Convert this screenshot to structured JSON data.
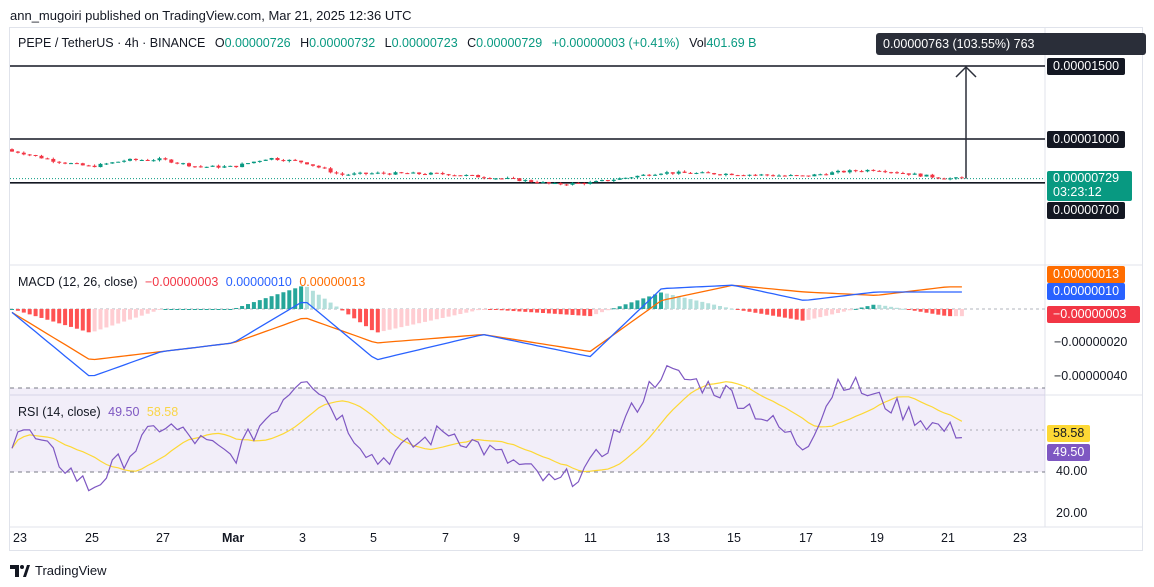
{
  "publisher": "ann_mugoiri published on TradingView.com, Mar 21, 2025 12:36 UTC",
  "legend": {
    "symbol": "PEPE / TetherUS · 4h · BINANCE",
    "open_label": "O",
    "open": "0.00000726",
    "high_label": "H",
    "high": "0.00000732",
    "low_label": "L",
    "low": "0.00000723",
    "close_label": "C",
    "close": "0.00000729",
    "change": "+0.00000003 (+0.41%)",
    "vol_label": "Vol",
    "vol": "401.69 B"
  },
  "measure_label": "0.00000763 (103.55%) 763",
  "price_axis": {
    "level_1500": "0.00001500",
    "level_1000": "0.00001000",
    "current": "0.00000729",
    "countdown": "03:23:12",
    "level_700": "0.00000700"
  },
  "macd": {
    "title": "MACD (12, 26, close)",
    "hist_value": "−0.00000003",
    "macd_value": "0.00000010",
    "signal_value": "0.00000013",
    "axis": {
      "signal_badge": "0.00000013",
      "macd_badge": "0.00000010",
      "hist_badge": "−0.00000003",
      "tick_20": "−0.00000020",
      "tick_40": "−0.00000040"
    }
  },
  "rsi": {
    "title": "RSI (14, close)",
    "rsi_value": "49.50",
    "ma_value": "58.58",
    "axis": {
      "ma_badge": "58.58",
      "rsi_badge": "49.50",
      "tick_40": "40.00",
      "tick_20": "20.00"
    }
  },
  "time_axis": [
    "23",
    "25",
    "27",
    "Mar",
    "3",
    "5",
    "7",
    "9",
    "11",
    "13",
    "15",
    "17",
    "19",
    "21",
    "23"
  ],
  "footer": "TradingView",
  "colors": {
    "up": "#089981",
    "down": "#f23645",
    "macd": "#2962ff",
    "signal": "#ff6d00",
    "hist_up_strong": "#26a69a",
    "hist_up_weak": "#b2dfdb",
    "hist_dn_strong": "#ff5252",
    "hist_dn_weak": "#ffcdd2",
    "rsi": "#7e57c2",
    "rsi_ma": "#fdd835"
  },
  "chart_data": {
    "type": "candlestick",
    "title": "PEPE / TetherUS · 4h · BINANCE",
    "ohlc_sample": [
      {
        "t": "Feb 22",
        "o": 9.3,
        "h": 9.4,
        "l": 9.2,
        "c": 9.3
      },
      {
        "t": "Feb 23",
        "o": 9.25,
        "h": 9.35,
        "l": 9.05,
        "c": 9.1
      },
      {
        "t": "Feb 24",
        "o": 9.0,
        "h": 9.05,
        "l": 8.4,
        "c": 8.5
      },
      {
        "t": "Feb 25",
        "o": 8.2,
        "h": 8.35,
        "l": 8.0,
        "c": 8.1
      },
      {
        "t": "Feb 26",
        "o": 8.4,
        "h": 8.6,
        "l": 8.35,
        "c": 8.55
      },
      {
        "t": "Feb 27",
        "o": 8.55,
        "h": 8.7,
        "l": 8.5,
        "c": 8.6
      },
      {
        "t": "Feb 28",
        "o": 8.3,
        "h": 8.4,
        "l": 8.0,
        "c": 8.1
      },
      {
        "t": "Mar 1",
        "o": 8.05,
        "h": 8.2,
        "l": 7.95,
        "c": 8.1
      },
      {
        "t": "Mar 2",
        "o": 8.4,
        "h": 8.8,
        "l": 8.3,
        "c": 8.7
      },
      {
        "t": "Mar 3",
        "o": 8.9,
        "h": 8.95,
        "l": 8.3,
        "c": 8.4
      },
      {
        "t": "Mar 4",
        "o": 7.7,
        "h": 7.8,
        "l": 7.4,
        "c": 7.55
      },
      {
        "t": "Mar 5",
        "o": 7.6,
        "h": 7.75,
        "l": 7.5,
        "c": 7.65
      },
      {
        "t": "Mar 7",
        "o": 7.7,
        "h": 7.8,
        "l": 7.5,
        "c": 7.6
      },
      {
        "t": "Mar 9",
        "o": 7.3,
        "h": 7.4,
        "l": 7.1,
        "c": 7.2
      },
      {
        "t": "Mar 10",
        "o": 7.0,
        "h": 7.1,
        "l": 6.8,
        "c": 6.9
      },
      {
        "t": "Mar 11",
        "o": 6.8,
        "h": 7.05,
        "l": 6.7,
        "c": 7.0
      },
      {
        "t": "Mar 13",
        "o": 7.5,
        "h": 7.75,
        "l": 7.45,
        "c": 7.7
      },
      {
        "t": "Mar 15",
        "o": 7.6,
        "h": 7.7,
        "l": 7.5,
        "c": 7.6
      },
      {
        "t": "Mar 17",
        "o": 7.4,
        "h": 7.55,
        "l": 7.3,
        "c": 7.45
      },
      {
        "t": "Mar 18",
        "o": 7.6,
        "h": 7.8,
        "l": 7.55,
        "c": 7.75
      },
      {
        "t": "Mar 19",
        "o": 7.65,
        "h": 7.95,
        "l": 7.6,
        "c": 7.9
      },
      {
        "t": "Mar 21",
        "o": 7.26,
        "h": 7.32,
        "l": 7.23,
        "c": 7.29
      }
    ],
    "ohlc_unit": "1e-6 USDT",
    "horizontal_levels": [
      1.5e-05,
      1e-05,
      7e-06
    ],
    "macd_sample": [
      {
        "t": "Feb 25",
        "macd": -0.4,
        "signal": -0.3
      },
      {
        "t": "Feb 27",
        "macd": -0.25,
        "signal": -0.25
      },
      {
        "t": "Mar 1",
        "macd": -0.2,
        "signal": -0.2
      },
      {
        "t": "Mar 3",
        "macd": 0.05,
        "signal": -0.05
      },
      {
        "t": "Mar 5",
        "macd": -0.3,
        "signal": -0.2
      },
      {
        "t": "Mar 8",
        "macd": -0.15,
        "signal": -0.15
      },
      {
        "t": "Mar 11",
        "macd": -0.28,
        "signal": -0.25
      },
      {
        "t": "Mar 13",
        "macd": 0.12,
        "signal": 0.05
      },
      {
        "t": "Mar 15",
        "macd": 0.14,
        "signal": 0.14
      },
      {
        "t": "Mar 17",
        "macd": 0.05,
        "signal": 0.1
      },
      {
        "t": "Mar 19",
        "macd": 0.1,
        "signal": 0.08
      },
      {
        "t": "Mar 21",
        "macd": 0.1,
        "signal": 0.13
      }
    ],
    "macd_unit": "1e-6",
    "rsi_sample": [
      {
        "t": "Feb 23",
        "rsi": 52
      },
      {
        "t": "Feb 25",
        "rsi": 22
      },
      {
        "t": "Feb 27",
        "rsi": 53
      },
      {
        "t": "Mar 1",
        "rsi": 37
      },
      {
        "t": "Mar 3",
        "rsi": 78
      },
      {
        "t": "Mar 5",
        "rsi": 35
      },
      {
        "t": "Mar 7",
        "rsi": 50
      },
      {
        "t": "Mar 9",
        "rsi": 33
      },
      {
        "t": "Mar 10",
        "rsi": 24
      },
      {
        "t": "Mar 11",
        "rsi": 32
      },
      {
        "t": "Mar 13",
        "rsi": 78
      },
      {
        "t": "Mar 15",
        "rsi": 67
      },
      {
        "t": "Mar 17",
        "rsi": 42
      },
      {
        "t": "Mar 18",
        "rsi": 75
      },
      {
        "t": "Mar 19",
        "rsi": 65
      },
      {
        "t": "Mar 21",
        "rsi": 49.5
      }
    ],
    "rsi_bands": [
      30,
      70
    ]
  }
}
